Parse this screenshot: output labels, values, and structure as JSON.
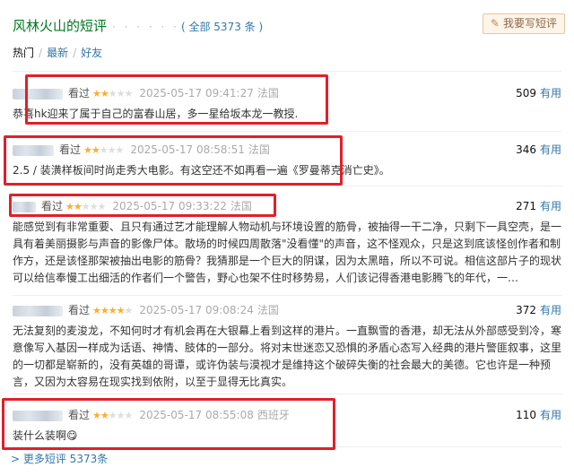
{
  "header": {
    "title": "风林火山的短评",
    "dots": "· · · · · ·",
    "total": "( 全部 5373 条 )",
    "write_button": "我要写短评",
    "pencil_icon": "pencil-icon"
  },
  "tabs": {
    "hot": "热门",
    "latest": "最新",
    "friends": "好友",
    "sep": "/"
  },
  "comments": [
    {
      "watched": "看过",
      "rating": 2,
      "time": "2025-05-17 09:41:27",
      "location": "法国",
      "votes": "509",
      "useful": "有用",
      "text": "恭喜hk迎来了属于自己的富春山居，多一星给坂本龙一教授."
    },
    {
      "watched": "看过",
      "rating": 2,
      "time": "2025-05-17 08:58:51",
      "location": "法国",
      "votes": "346",
      "useful": "有用",
      "text": "2.5 / 装潢样板间时尚走秀大电影。有这空还不如再看一遍《罗曼蒂克消亡史》。"
    },
    {
      "watched": "看过",
      "rating": 2,
      "time": "2025-05-17 09:33:22",
      "location": "法国",
      "votes": "271",
      "useful": "有用",
      "text": "能感觉到有非常重要、且只有通过艺才能理解人物动机与环境设置的筋骨，被抽得一干二净，只剩下一具空壳，是一具有着美丽摄影与声音的影像尸体。散场的时候四周散落\"没看懂\"的声音，这不怪观众，只是这到底该怪创作者和制作方，还是该怪那架被抽出电影的筋骨？我猜那是一个巨大的阴谋，因为太黑暗，所以不可说。相信这部片子的现状可以给信奉慢工出细活的作者们一个警告，野心也架不住时移势易，人们该记得香港电影腾飞的年代，一…"
    },
    {
      "watched": "看过",
      "rating": 4,
      "time": "2025-05-17 09:08:24",
      "location": "法国",
      "votes": "372",
      "useful": "有用",
      "text": "无法复刻的麦浚龙，不知何时才有机会再在大银幕上看到这样的港片。一直飘雪的香港，却无法从外部感受到冷，寒意像写入基因一样成为话语、神情、肢体的一部分。将对末世迷恋又恐惧的矛盾心态写入经典的港片警匪叙事，这里的一切都是崭新的，没有英雄的哥谭，或许伪装与漠视才是维持这个破碎失衡的社会最大的美德。它也许是一种预言，又因为太容易在现实找到依附，以至于显得无比真实。"
    },
    {
      "watched": "看过",
      "rating": 2,
      "time": "2025-05-17 08:55:08",
      "location": "西班牙",
      "votes": "110",
      "useful": "有用",
      "text": "装什么装啊😋"
    }
  ],
  "footer": {
    "more": "> 更多短评 5373条"
  },
  "colors": {
    "accent_green": "#007722",
    "link_blue": "#3377aa",
    "star": "#ffac2d",
    "highlight_red": "#e0202a"
  }
}
